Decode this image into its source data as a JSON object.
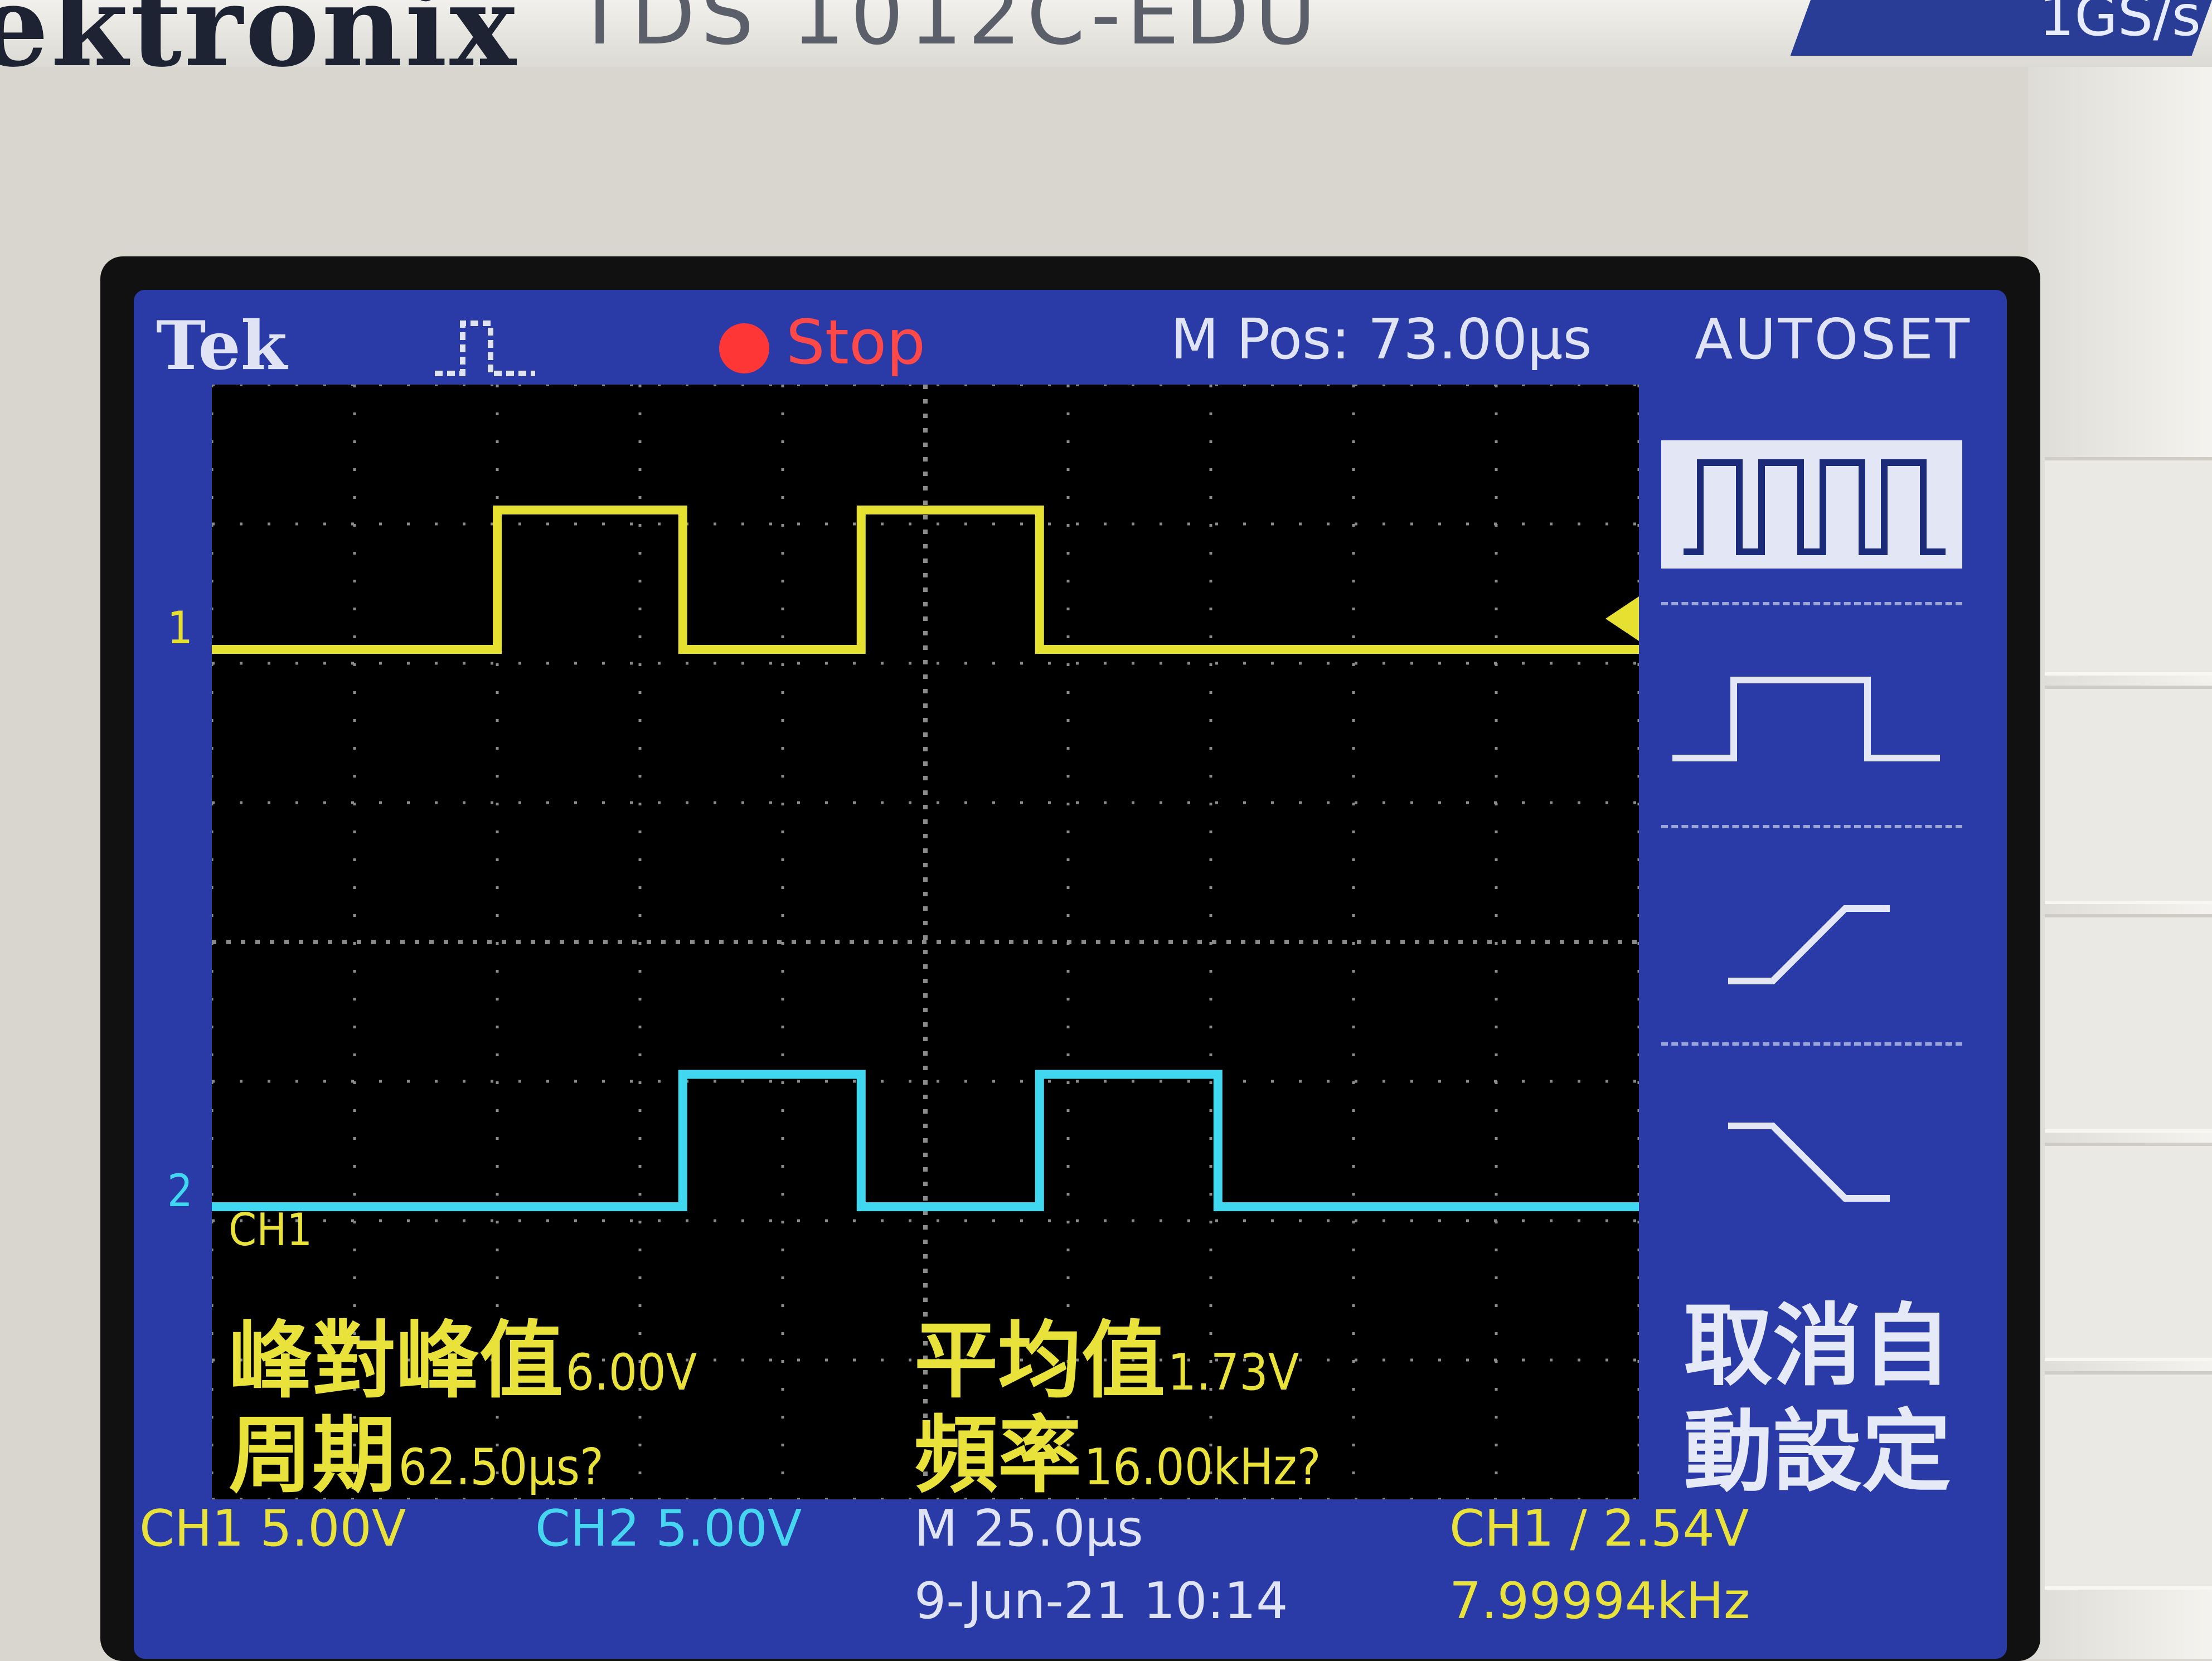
{
  "device": {
    "brand": "ektronix",
    "model": "TDS 1012C-EDU",
    "sample_rate_badge": "1GS/s"
  },
  "status_bar": {
    "brand_logo": "Tek",
    "acquisition_state": "Stop",
    "m_pos": "M Pos: 73.00µs",
    "menu_title": "AUTOSET"
  },
  "measurements": {
    "channel": "CH1",
    "items": [
      {
        "label": "峰對峰值",
        "value": "6.00V"
      },
      {
        "label": "平均值",
        "value": "1.73V"
      },
      {
        "label": "周期",
        "value": "62.50µs?"
      },
      {
        "label": "頻率",
        "value": "16.00kHz?"
      }
    ]
  },
  "side_menu": {
    "cancel_label_line1": "取消自",
    "cancel_label_line2": "動設定",
    "icons": [
      "multi-cycle-square-icon",
      "single-pulse-icon",
      "rising-edge-icon",
      "falling-edge-icon"
    ]
  },
  "bottom_bar": {
    "ch1_scale": "CH1  5.00V",
    "ch2_scale": "CH2  5.00V",
    "timebase": "M 25.0µs",
    "date_time": "9-Jun-21 10:14",
    "trigger": "CH1 ∕ 2.54V",
    "trigger_freq": "7.99994kHz"
  },
  "markers": {
    "ch1": "1",
    "ch2": "2"
  },
  "traces": {
    "ch1_color": "#e6e030",
    "ch2_color": "#40d8f0",
    "ch1_pulses_div": [
      [
        2.0,
        3.3
      ],
      [
        4.55,
        5.8
      ]
    ],
    "ch2_pulses_div": [
      [
        3.3,
        4.55
      ],
      [
        5.8,
        7.05
      ]
    ],
    "ch1_baseline_div": 1.9,
    "ch1_high_div": 0.9,
    "ch2_baseline_div": 5.9,
    "ch2_high_div": 4.95
  }
}
